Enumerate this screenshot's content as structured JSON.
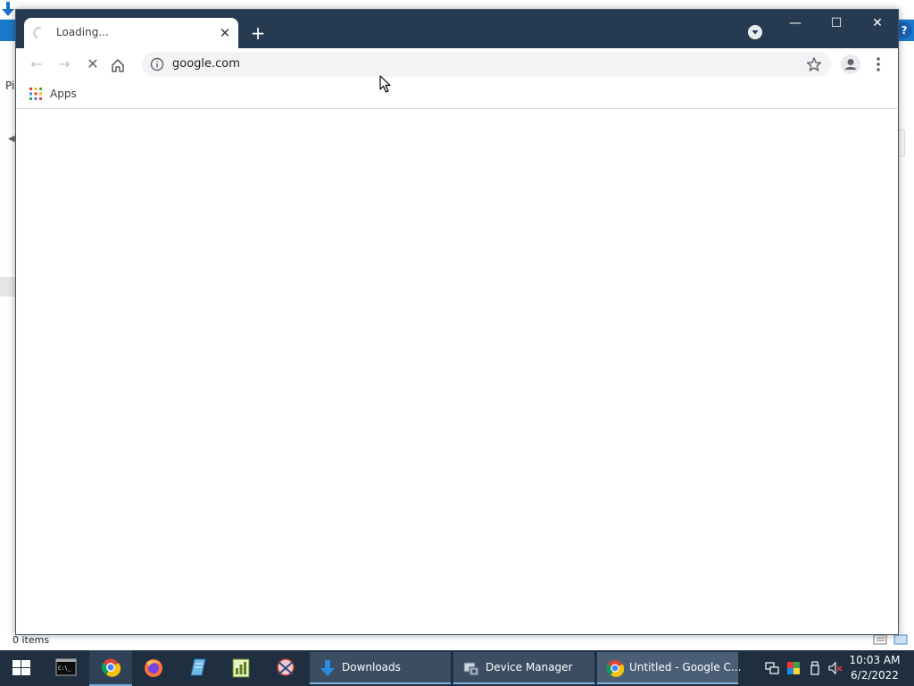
{
  "background_window": {
    "left_text": "Pi",
    "status_text": "0 items"
  },
  "browser": {
    "tab": {
      "title": "Loading...",
      "close_glyph": "✕"
    },
    "new_tab_glyph": "+",
    "window_controls": {
      "minimize": "—",
      "maximize": "☐",
      "close": "✕"
    },
    "toolbar": {
      "back_glyph": "←",
      "forward_glyph": "→",
      "stop_glyph": "✕"
    },
    "omnibox": {
      "url": "google.com"
    },
    "bookmarks": {
      "apps_label": "Apps"
    }
  },
  "taskbar": {
    "tasks": [
      {
        "label": "Downloads"
      },
      {
        "label": "Device Manager"
      },
      {
        "label": "Untitled - Google C..."
      }
    ],
    "clock": {
      "time": "10:03 AM",
      "date": "6/2/2022"
    }
  },
  "colors": {
    "chrome_frame": "#263b51",
    "taskbar": "#1f2f40",
    "ribbon_blue": "#1979ca",
    "omnibox_bg": "#f1f3f4"
  }
}
